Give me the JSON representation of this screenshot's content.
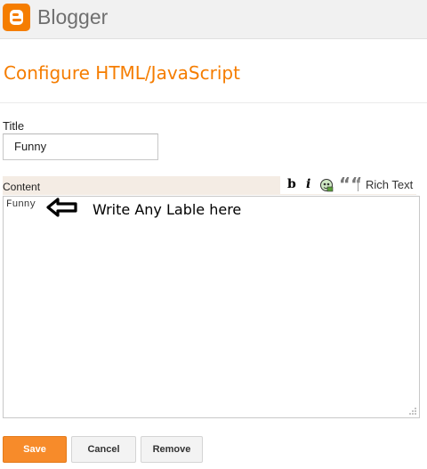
{
  "header": {
    "logo_icon": "blogger-logo-icon",
    "app_name": "Blogger"
  },
  "page": {
    "title": "Configure HTML/JavaScript"
  },
  "form": {
    "title_label": "Title",
    "title_value": "Funny",
    "content_label": "Content",
    "content_value": "Funny"
  },
  "toolbar": {
    "bold_label": "b",
    "italic_label": "i",
    "image_icon": "image-icon",
    "quote_label": "““",
    "rich_text_label": "Rich Text"
  },
  "annotation": {
    "arrow_icon": "left-arrow-icon",
    "text": "Write Any Lable here"
  },
  "buttons": {
    "save_label": "Save",
    "cancel_label": "Cancel",
    "remove_label": "Remove"
  },
  "colors": {
    "accent": "#f57d00",
    "save_button": "#f78b2a",
    "header_bg": "#f1f1f1",
    "content_bar_bg": "#f4ece4"
  }
}
